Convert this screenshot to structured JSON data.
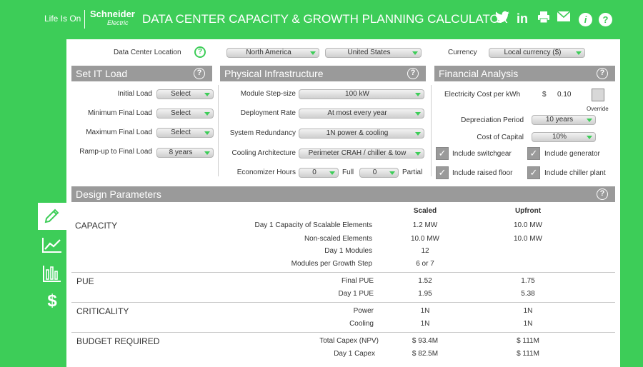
{
  "header": {
    "life_is_on": "Life Is On",
    "brand_name": "Schneider",
    "brand_sub": "Electric",
    "title": "DATA CENTER CAPACITY & GROWTH PLANNING CALCULATOR"
  },
  "top_row": {
    "location_label": "Data Center Location",
    "region": "North America",
    "country": "United States",
    "currency_label": "Currency",
    "currency": "Local currency ($)"
  },
  "it_load": {
    "title": "Set IT Load",
    "rows": [
      {
        "label": "Initial Load",
        "value": "Select"
      },
      {
        "label": "Minimum Final Load",
        "value": "Select"
      },
      {
        "label": "Maximum Final Load",
        "value": "Select"
      },
      {
        "label": "Ramp-up to Final Load",
        "value": "8 years"
      }
    ]
  },
  "physical": {
    "title": "Physical Infrastructure",
    "rows": [
      {
        "label": "Module Step-size",
        "value": "100 kW"
      },
      {
        "label": "Deployment Rate",
        "value": "At most every year"
      },
      {
        "label": "System Redundancy",
        "value": "1N power & cooling"
      },
      {
        "label": "Cooling Architecture",
        "value": "Perimeter CRAH / chiller & tow"
      }
    ],
    "economizer_label": "Economizer Hours",
    "economizer_full": "0",
    "full_label": "Full",
    "economizer_partial": "0",
    "partial_label": "Partial"
  },
  "financial": {
    "title": "Financial Analysis",
    "electricity_label": "Electricity Cost per kWh",
    "electricity_currency": "$",
    "electricity_value": "0.10",
    "override_label": "Override",
    "depreciation_label": "Depreciation Period",
    "depreciation_value": "10 years",
    "capital_label": "Cost of Capital",
    "capital_value": "10%",
    "checks": [
      {
        "label": "Include switchgear",
        "checked": true
      },
      {
        "label": "Include generator",
        "checked": true
      },
      {
        "label": "Include raised floor",
        "checked": true
      },
      {
        "label": "Include chiller plant",
        "checked": true
      }
    ]
  },
  "design": {
    "title": "Design Parameters",
    "col_scaled": "Scaled",
    "col_upfront": "Upfront",
    "capacity": {
      "title": "CAPACITY",
      "rows": [
        {
          "label": "Day 1 Capacity of Scalable Elements",
          "scaled": "1.2 MW",
          "upfront": "10.0 MW"
        },
        {
          "label": "Non-scaled Elements",
          "scaled": "10.0 MW",
          "upfront": "10.0 MW"
        },
        {
          "label": "Day 1  Modules",
          "scaled": "12",
          "upfront": ""
        },
        {
          "label": "Modules per Growth Step",
          "scaled": "6 or 7",
          "upfront": ""
        }
      ]
    },
    "pue": {
      "title": "PUE",
      "rows": [
        {
          "label": "Final PUE",
          "scaled": "1.52",
          "upfront": "1.75"
        },
        {
          "label": "Day 1 PUE",
          "scaled": "1.95",
          "upfront": "5.38"
        }
      ]
    },
    "criticality": {
      "title": "CRITICALITY",
      "rows": [
        {
          "label": "Power",
          "scaled": "1N",
          "upfront": "1N"
        },
        {
          "label": "Cooling",
          "scaled": "1N",
          "upfront": "1N"
        }
      ]
    },
    "budget": {
      "title": "BUDGET REQUIRED",
      "rows": [
        {
          "label": "Total Capex (NPV)",
          "scaled": "$ 93.4M",
          "upfront": "$ 111M"
        },
        {
          "label": "Day 1 Capex",
          "scaled": "$ 82.5M",
          "upfront": "$ 111M"
        }
      ]
    }
  }
}
